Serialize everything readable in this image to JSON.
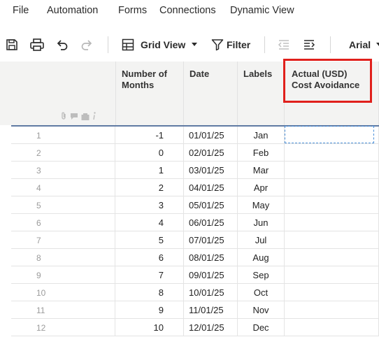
{
  "menu": [
    "File",
    "Automation",
    "Forms",
    "Connections",
    "Dynamic View"
  ],
  "toolbar": {
    "view_label": "Grid View",
    "filter_label": "Filter",
    "font_label": "Arial"
  },
  "columns": {
    "months": "Number of\nMonths",
    "date": "Date",
    "labels": "Labels",
    "actual": "Actual (USD)\nCost Avoidance"
  },
  "rows": [
    {
      "n": "1",
      "months": "-1",
      "date": "01/01/25",
      "label": "Jan"
    },
    {
      "n": "2",
      "months": "0",
      "date": "02/01/25",
      "label": "Feb"
    },
    {
      "n": "3",
      "months": "1",
      "date": "03/01/25",
      "label": "Mar"
    },
    {
      "n": "4",
      "months": "2",
      "date": "04/01/25",
      "label": "Apr"
    },
    {
      "n": "5",
      "months": "3",
      "date": "05/01/25",
      "label": "May"
    },
    {
      "n": "6",
      "months": "4",
      "date": "06/01/25",
      "label": "Jun"
    },
    {
      "n": "7",
      "months": "5",
      "date": "07/01/25",
      "label": "Jul"
    },
    {
      "n": "8",
      "months": "6",
      "date": "08/01/25",
      "label": "Aug"
    },
    {
      "n": "9",
      "months": "7",
      "date": "09/01/25",
      "label": "Sep"
    },
    {
      "n": "10",
      "months": "8",
      "date": "10/01/25",
      "label": "Oct"
    },
    {
      "n": "11",
      "months": "9",
      "date": "11/01/25",
      "label": "Nov"
    },
    {
      "n": "12",
      "months": "10",
      "date": "12/01/25",
      "label": "Dec"
    }
  ]
}
